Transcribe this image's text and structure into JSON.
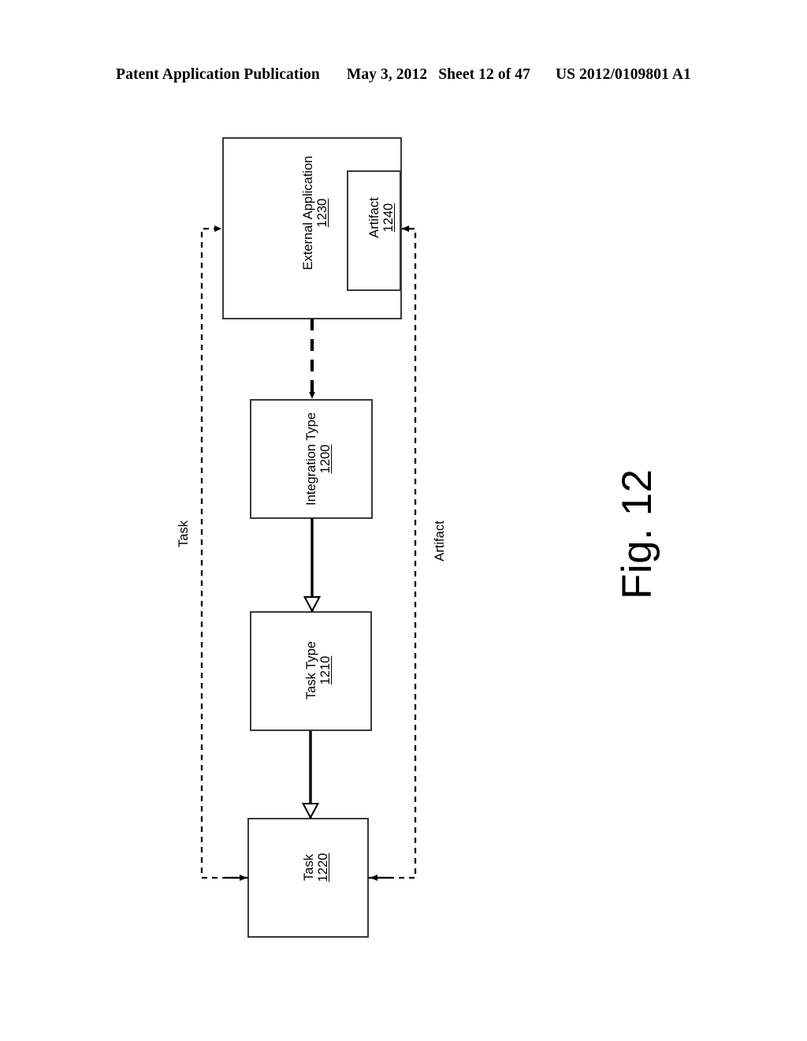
{
  "header": {
    "publication": "Patent Application Publication",
    "date": "May 3, 2012",
    "sheet": "Sheet 12 of 47",
    "patent_number": "US 2012/0109801 A1"
  },
  "figure": {
    "caption": "Fig. 12",
    "nodes": [
      {
        "id": "external-application",
        "title": "External Application",
        "ref": "1230"
      },
      {
        "id": "artifact",
        "title": "Artifact",
        "ref": "1240"
      },
      {
        "id": "integration-type",
        "title": "Integration Type",
        "ref": "1200"
      },
      {
        "id": "task-type",
        "title": "Task Type",
        "ref": "1210"
      },
      {
        "id": "task",
        "title": "Task",
        "ref": "1220"
      }
    ],
    "edge_labels": [
      {
        "id": "task-association",
        "label": "Task"
      },
      {
        "id": "artifact-association",
        "label": "Artifact"
      }
    ]
  },
  "colors": {
    "ink": "#000000",
    "paper": "#ffffff",
    "box_stroke": "#2b2b2b"
  }
}
